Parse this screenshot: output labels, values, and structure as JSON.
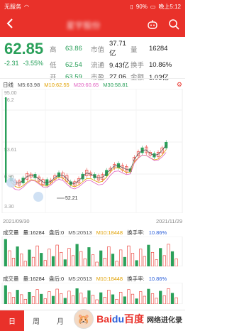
{
  "status_bar": {
    "carrier": "无服务",
    "battery": "90%",
    "time": "晚上5:12"
  },
  "header": {
    "back_icon": "chevron-left-icon",
    "title": "星宇股份",
    "robot_icon": "robot-icon",
    "search_icon": "search-icon"
  },
  "quote": {
    "price": "62.85",
    "change": "-2.31",
    "change_pct": "-3.55%",
    "rows": [
      {
        "l1": "高",
        "v1": "63.86",
        "l2": "市值",
        "v2": "37.71亿",
        "l3": "量",
        "v3": "16284"
      },
      {
        "l1": "低",
        "v1": "62.54",
        "l2": "流通",
        "v2": "9.43亿",
        "l3": "换手",
        "v3": "10.86%"
      },
      {
        "l1": "开",
        "v1": "63.59",
        "l2": "市盈",
        "v2": "27.06",
        "l3": "金额",
        "v3": "1.03亿"
      }
    ]
  },
  "kline": {
    "period_label": "日线",
    "ma5": "M5:63.98",
    "ma10": "M10:62.55",
    "ma20": "M20:60.65",
    "ma30": "M30:58.81",
    "y_top": "95.00",
    "y_mid": "76.2",
    "y_ticks": [
      "95.00",
      "76.2",
      "53.61",
      "0.95",
      "3.30"
    ],
    "price_high_label": "95.00",
    "low_label": "52.21",
    "date_start": "2021/09/30",
    "date_end": "2021/11/29"
  },
  "volume_panels": [
    {
      "label": "成交量",
      "vol": "量:16284",
      "pan": "盘后:0",
      "m5": "M5:20513",
      "m10": "M10:18448",
      "turnover_label": "换手率:",
      "turnover": "10.86%"
    },
    {
      "label": "成交量",
      "vol": "量:16284",
      "pan": "盘后:0",
      "m5": "M5:20513",
      "m10": "M10:18448",
      "turnover_label": "换手率:",
      "turnover": "10.86%"
    }
  ],
  "tabs": [
    {
      "label": "日"
    },
    {
      "label": "周"
    },
    {
      "label": "月"
    }
  ],
  "watermark": {
    "logo_bai": "Bai",
    "logo_du": "du",
    "logo_cn": "百度",
    "text": "网络进化录"
  },
  "colors": {
    "accent": "#e9312a",
    "down": "#2aa05a",
    "ma5": "#555555",
    "ma10": "#e0a000",
    "ma20": "#e060c0",
    "ma30": "#2aa05a"
  }
}
